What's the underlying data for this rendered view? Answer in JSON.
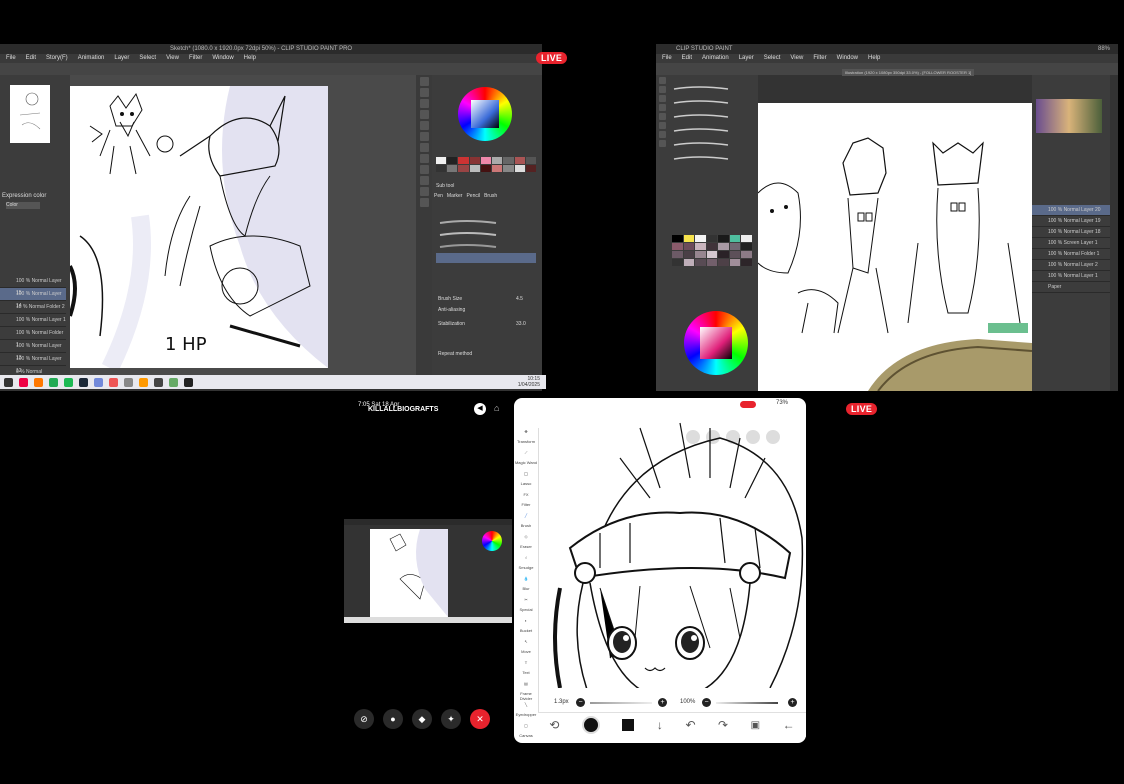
{
  "live_label": "LIVE",
  "screen1": {
    "title": "Sketch* (1080.0 x 1920.0px 72dpi 50%) - CLIP STUDIO PAINT PRO",
    "menu": [
      "File",
      "Edit",
      "Story(F)",
      "Animation",
      "Layer",
      "Select",
      "View",
      "Filter",
      "Window",
      "Help"
    ],
    "color_set_label": "Expression color",
    "color_set_value": "Color",
    "layers": [
      "100 % Normal Layer 15",
      "100 % Normal Layer 14",
      "18 % Normal Folder 2",
      "100 % Normal Layer 1",
      "100 % Normal Folder 1",
      "100 % Normal Layer 13",
      "100 % Normal Layer 12",
      "0 % Normal"
    ],
    "subtool_label": "Sub tool",
    "brush_items": [
      "Pen",
      "Marker",
      "Pencil",
      "Brush"
    ],
    "brush_size_label": "Brush Size",
    "brush_size_value": "4.5",
    "antialias_label": "Anti-aliasing",
    "color_stab_label": "Stabilization",
    "color_stab_value": "33.0",
    "repeat_label": "Repeat method",
    "canvas_text": "1 HP",
    "time": "10:15",
    "date": "1/04/2025"
  },
  "screen2": {
    "title": "CLIP STUDIO PAINT",
    "menu": [
      "File",
      "Edit",
      "Animation",
      "Layer",
      "Select",
      "View",
      "Filter",
      "Window",
      "Help"
    ],
    "tab_label": "Illustration (1920 x 1080px 350dpi 33.0%) - [FOLLOWER ROOSTER 1]",
    "battery": "88%",
    "layers": [
      "100 % Normal Layer 20",
      "100 % Normal Layer 19",
      "100 % Normal Layer 18",
      "100 % Screen Layer 1",
      "100 % Normal Folder 1",
      "100 % Normal Layer 2",
      "100 % Normal Layer 1",
      "Paper"
    ]
  },
  "call": {
    "time": "7:05",
    "date": "Sat 18 Apr",
    "username": "KILLALLBIOGRAFTS"
  },
  "tablet": {
    "battery": "73%",
    "brush_size": "1.3px",
    "opacity": "100%",
    "tools": [
      "Transform",
      "Magic Wand",
      "Lasso",
      "Filter",
      "Brush",
      "Eraser",
      "Smudge",
      "Blur",
      "Special",
      "Bucket",
      "Move",
      "Text",
      "Frame Divider",
      "Eyedropper",
      "Canvas"
    ]
  }
}
